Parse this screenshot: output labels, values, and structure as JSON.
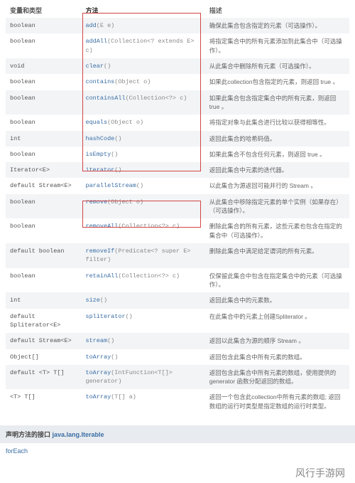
{
  "headers": {
    "ret": "变量和类型",
    "meth": "方法",
    "desc": "描述"
  },
  "rows": [
    {
      "ret": "boolean",
      "meth_a": "add",
      "meth_b": "(E e)",
      "desc": "确保此集合包含指定的元素（可选操作）。"
    },
    {
      "ret": "boolean",
      "meth_a": "addAll",
      "meth_b": "(Collection<? extends E> c)",
      "desc": "将指定集合中的所有元素添加到此集合中（可选操作）。"
    },
    {
      "ret": "void",
      "meth_a": "clear",
      "meth_b": "()",
      "desc": "从此集合中删除所有元素（可选操作）。"
    },
    {
      "ret": "boolean",
      "meth_a": "contains",
      "meth_b": "(Object o)",
      "desc": "如果此collection包含指定的元素，则返回 true 。"
    },
    {
      "ret": "boolean",
      "meth_a": "containsAll",
      "meth_b": "(Collection<?> c)",
      "desc": "如果此集合包含指定集合中的所有元素，则返回 true 。"
    },
    {
      "ret": "boolean",
      "meth_a": "equals",
      "meth_b": "(Object o)",
      "desc": "将指定对象与此集合进行比较以获得相等性。"
    },
    {
      "ret": "int",
      "meth_a": "hashCode",
      "meth_b": "()",
      "desc": "返回此集合的哈希码值。"
    },
    {
      "ret": "boolean",
      "meth_a": "isEmpty",
      "meth_b": "()",
      "desc": "如果此集合不包含任何元素，则返回 true 。"
    },
    {
      "ret": "Iterator<E>",
      "meth_a": "iterator",
      "meth_b": "()",
      "desc": "返回此集合中元素的迭代器。"
    },
    {
      "ret": "default Stream<E>",
      "meth_a": "parallelStream",
      "meth_b": "()",
      "desc": "以此集合为源返回可能并行的 Stream 。"
    },
    {
      "ret": "boolean",
      "meth_a": "remove",
      "meth_b": "(Object o)",
      "desc": "从此集合中移除指定元素的单个实例（如果存在）（可选操作）。"
    },
    {
      "ret": "boolean",
      "meth_a": "removeAll",
      "meth_b": "(Collection<?> c)",
      "desc": "删除此集合的所有元素，这些元素也包含在指定的集合中（可选操作）。"
    },
    {
      "ret": "default boolean",
      "meth_a": "removeIf",
      "meth_b": "(Predicate<? super E> filter)",
      "desc": "删除此集合中满足给定谓词的所有元素。"
    },
    {
      "ret": "boolean",
      "meth_a": "retainAll",
      "meth_b": "(Collection<?> c)",
      "desc": "仅保留此集合中包含在指定集合中的元素（可选操作）。"
    },
    {
      "ret": "int",
      "meth_a": "size",
      "meth_b": "()",
      "desc": "返回此集合中的元素数。"
    },
    {
      "ret": "default Spliterator<E>",
      "meth_a": "spliterator",
      "meth_b": "()",
      "desc": "在此集合中的元素上创建Spliterator 。"
    },
    {
      "ret": "default Stream<E>",
      "meth_a": "stream",
      "meth_b": "()",
      "desc": "返回以此集合为源的顺序 Stream 。"
    },
    {
      "ret": "Object[]",
      "meth_a": "toArray",
      "meth_b": "()",
      "desc": "返回包含此集合中所有元素的数组。"
    },
    {
      "ret": "default <T> T[]",
      "meth_a": "toArray",
      "meth_b": "(IntFunction<T[]> generator)",
      "desc": "返回包含此集合中所有元素的数组，使用提供的 generator 函数分配返回的数组。"
    },
    {
      "ret": "<T> T[]",
      "meth_a": "toArray",
      "meth_b": "(T[] a)",
      "desc": "返回一个包含此collection中所有元素的数组; 返回数组的运行时类型是指定数组的运行时类型。"
    }
  ],
  "section": {
    "prefix": "声明方法的接口 ",
    "iface": "java.lang.Iterable"
  },
  "inherited": "forEach",
  "watermark": "风行手游网"
}
